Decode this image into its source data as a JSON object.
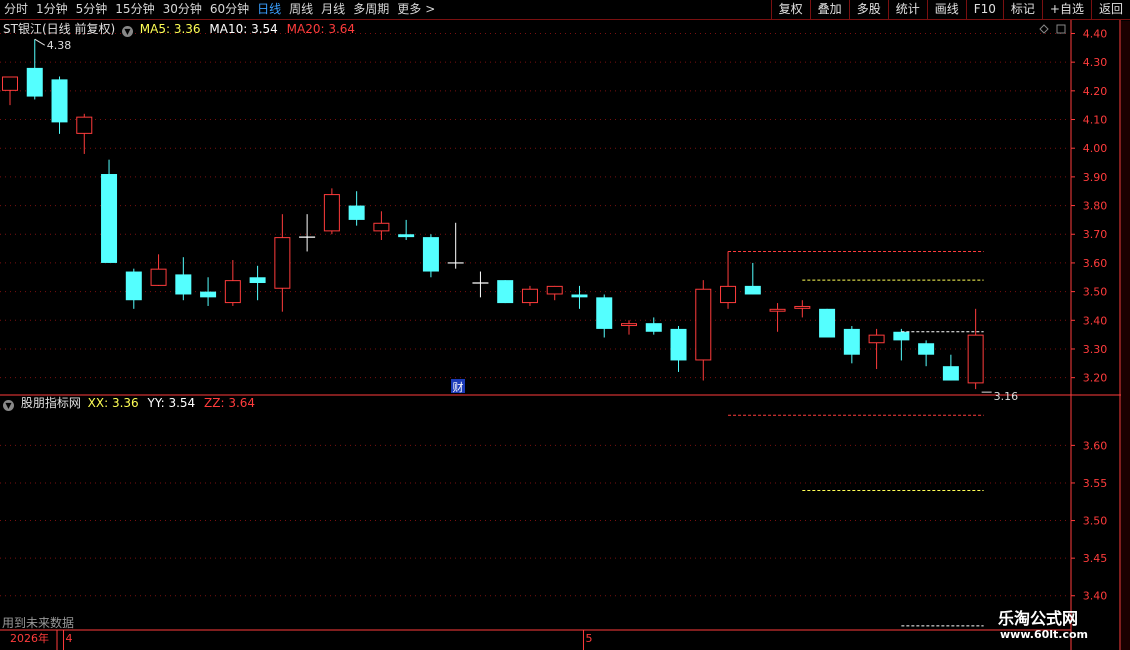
{
  "toolbar": {
    "periods": [
      {
        "label": "分时",
        "active": false
      },
      {
        "label": "1分钟",
        "active": false
      },
      {
        "label": "5分钟",
        "active": false
      },
      {
        "label": "15分钟",
        "active": false
      },
      {
        "label": "30分钟",
        "active": false
      },
      {
        "label": "60分钟",
        "active": false
      },
      {
        "label": "日线",
        "active": true
      },
      {
        "label": "周线",
        "active": false
      },
      {
        "label": "月线",
        "active": false
      },
      {
        "label": "多周期",
        "active": false
      },
      {
        "label": "更多",
        "active": false
      }
    ],
    "more_arrow": ">",
    "tools": [
      "复权",
      "叠加",
      "多股",
      "统计",
      "画线",
      "F10",
      "标记",
      "+自选",
      "返回"
    ]
  },
  "main_header": {
    "title": "ST银江(日线 前复权)",
    "ma5": "MA5: 3.36",
    "ma10": "MA10: 3.54",
    "ma20": "MA20: 3.64"
  },
  "indicator_header": {
    "title": "股朋指标网",
    "xx": "XX: 3.36",
    "yy": "YY: 3.54",
    "zz": "ZZ: 3.64"
  },
  "colors": {
    "up": "#ff3c3c",
    "down": "#54ffff",
    "doji": "#ffffff",
    "grid": "#7a1010",
    "axis": "#ff3c3c",
    "ma5": "#ffffff",
    "ma10": "#ffff55",
    "ma20": "#ff3c3c"
  },
  "price_axis": [
    "4.40",
    "4.30",
    "4.20",
    "4.10",
    "4.00",
    "3.90",
    "3.80",
    "3.70",
    "3.60",
    "3.50",
    "3.40",
    "3.30",
    "3.20"
  ],
  "indicator_axis": [
    "3.60",
    "3.55",
    "3.50",
    "3.45",
    "3.40"
  ],
  "annotations": {
    "high": "4.38",
    "low": "3.16",
    "cai": "财"
  },
  "footer_note": "用到未来数据",
  "date_axis": {
    "year": "2026年",
    "m4": "4",
    "m5": "5"
  },
  "watermark": {
    "title": "乐淘公式网",
    "url": "www.60lt.com"
  },
  "chart_data": {
    "type": "candlestick",
    "y_range": [
      3.15,
      4.44
    ],
    "candles": [
      {
        "o": 4.2,
        "h": 4.25,
        "l": 4.15,
        "c": 4.25
      },
      {
        "o": 4.28,
        "h": 4.38,
        "l": 4.17,
        "c": 4.18
      },
      {
        "o": 4.24,
        "h": 4.25,
        "l": 4.05,
        "c": 4.09
      },
      {
        "o": 4.05,
        "h": 4.12,
        "l": 3.98,
        "c": 4.11
      },
      {
        "o": 3.91,
        "h": 3.96,
        "l": 3.6,
        "c": 3.6
      },
      {
        "o": 3.57,
        "h": 3.58,
        "l": 3.44,
        "c": 3.47
      },
      {
        "o": 3.52,
        "h": 3.63,
        "l": 3.52,
        "c": 3.58
      },
      {
        "o": 3.56,
        "h": 3.62,
        "l": 3.47,
        "c": 3.49
      },
      {
        "o": 3.5,
        "h": 3.55,
        "l": 3.45,
        "c": 3.48
      },
      {
        "o": 3.46,
        "h": 3.61,
        "l": 3.45,
        "c": 3.54
      },
      {
        "o": 3.55,
        "h": 3.59,
        "l": 3.47,
        "c": 3.53
      },
      {
        "o": 3.51,
        "h": 3.77,
        "l": 3.43,
        "c": 3.69
      },
      {
        "o": 3.69,
        "h": 3.77,
        "l": 3.64,
        "c": 3.69
      },
      {
        "o": 3.71,
        "h": 3.86,
        "l": 3.7,
        "c": 3.84
      },
      {
        "o": 3.8,
        "h": 3.85,
        "l": 3.73,
        "c": 3.75
      },
      {
        "o": 3.71,
        "h": 3.78,
        "l": 3.68,
        "c": 3.74
      },
      {
        "o": 3.7,
        "h": 3.75,
        "l": 3.68,
        "c": 3.69
      },
      {
        "o": 3.69,
        "h": 3.7,
        "l": 3.55,
        "c": 3.57
      },
      {
        "o": 3.6,
        "h": 3.74,
        "l": 3.58,
        "c": 3.6
      },
      {
        "o": 3.53,
        "h": 3.57,
        "l": 3.48,
        "c": 3.53
      },
      {
        "o": 3.54,
        "h": 3.54,
        "l": 3.46,
        "c": 3.46
      },
      {
        "o": 3.46,
        "h": 3.52,
        "l": 3.45,
        "c": 3.51
      },
      {
        "o": 3.49,
        "h": 3.52,
        "l": 3.47,
        "c": 3.52
      },
      {
        "o": 3.49,
        "h": 3.52,
        "l": 3.44,
        "c": 3.48
      },
      {
        "o": 3.48,
        "h": 3.49,
        "l": 3.34,
        "c": 3.37
      },
      {
        "o": 3.38,
        "h": 3.4,
        "l": 3.35,
        "c": 3.39
      },
      {
        "o": 3.39,
        "h": 3.41,
        "l": 3.35,
        "c": 3.36
      },
      {
        "o": 3.37,
        "h": 3.38,
        "l": 3.22,
        "c": 3.26
      },
      {
        "o": 3.26,
        "h": 3.54,
        "l": 3.19,
        "c": 3.51
      },
      {
        "o": 3.46,
        "h": 3.64,
        "l": 3.44,
        "c": 3.52
      },
      {
        "o": 3.52,
        "h": 3.6,
        "l": 3.49,
        "c": 3.49
      },
      {
        "o": 3.43,
        "h": 3.46,
        "l": 3.36,
        "c": 3.44
      },
      {
        "o": 3.44,
        "h": 3.47,
        "l": 3.41,
        "c": 3.45
      },
      {
        "o": 3.44,
        "h": 3.44,
        "l": 3.34,
        "c": 3.34
      },
      {
        "o": 3.37,
        "h": 3.38,
        "l": 3.25,
        "c": 3.28
      },
      {
        "o": 3.32,
        "h": 3.37,
        "l": 3.23,
        "c": 3.35
      },
      {
        "o": 3.36,
        "h": 3.37,
        "l": 3.26,
        "c": 3.33
      },
      {
        "o": 3.32,
        "h": 3.33,
        "l": 3.24,
        "c": 3.28
      },
      {
        "o": 3.24,
        "h": 3.28,
        "l": 3.19,
        "c": 3.19
      },
      {
        "o": 3.18,
        "h": 3.44,
        "l": 3.16,
        "c": 3.35
      }
    ],
    "ma_lines": [
      {
        "name": "MA20",
        "value": 3.64,
        "start_index": 29,
        "end_index": 39
      },
      {
        "name": "MA10",
        "value": 3.54,
        "start_index": 32,
        "end_index": 39
      },
      {
        "name": "MA5",
        "value": 3.36,
        "start_index": 36,
        "end_index": 39
      }
    ],
    "indicator": {
      "y_range": [
        3.397,
        3.667
      ],
      "lines": [
        {
          "name": "ZZ",
          "value": 3.64,
          "start_index": 29,
          "end_index": 39
        },
        {
          "name": "YY",
          "value": 3.54,
          "start_index": 32,
          "end_index": 39
        },
        {
          "name": "XX",
          "value": 3.36,
          "start_index": 36,
          "end_index": 39
        }
      ]
    },
    "x_labels": [
      {
        "text": "4",
        "index": 2
      },
      {
        "text": "5",
        "index": 23
      }
    ]
  }
}
